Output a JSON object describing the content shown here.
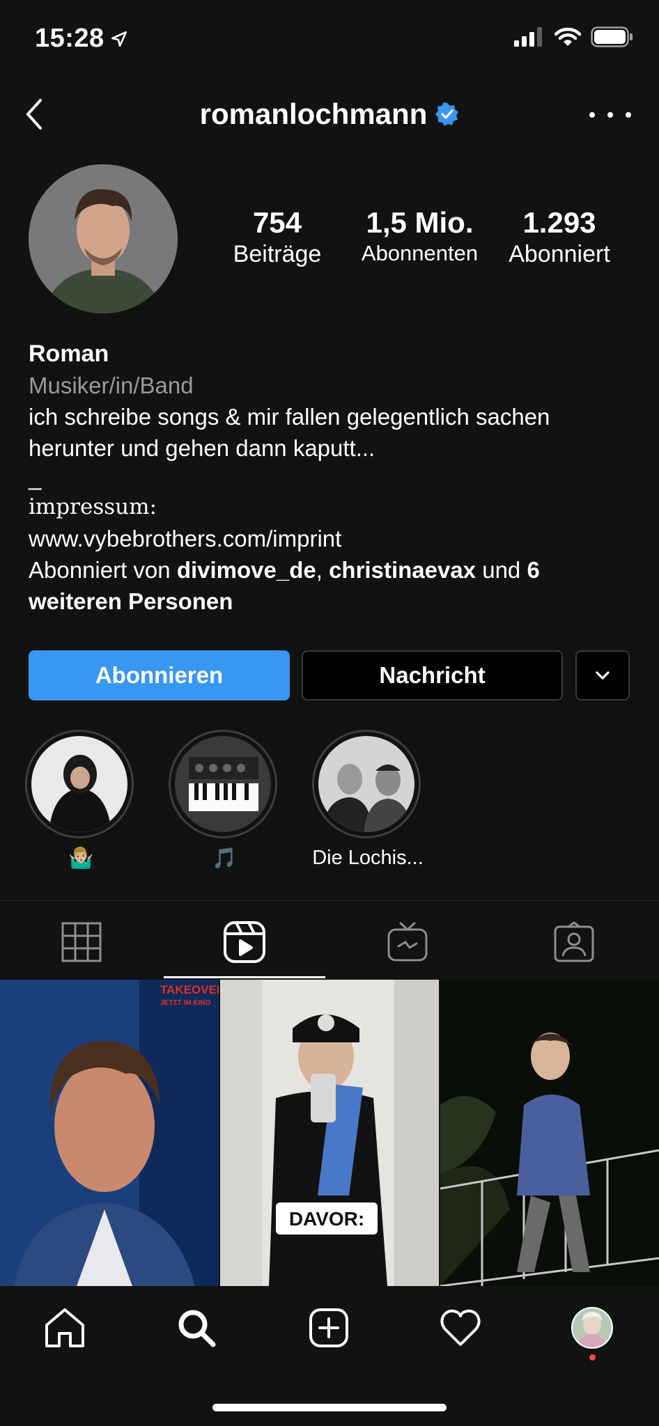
{
  "status": {
    "time": "15:28"
  },
  "header": {
    "username": "romanlochmann"
  },
  "stats": [
    {
      "value": "754",
      "label": "Beiträge"
    },
    {
      "value": "1,5 Mio.",
      "label": "Abonnenten"
    },
    {
      "value": "1.293",
      "label": "Abonniert"
    }
  ],
  "bio": {
    "name": "Roman",
    "category": "Musiker/in/Band",
    "text_line1": "ich schreibe songs & mir fallen gelegentlich sachen",
    "text_line2": "herunter und gehen dann kaputt...",
    "separator": "_",
    "impressum": "impressum:",
    "link": "www.vybebrothers.com/imprint",
    "followed_by_prefix": "Abonniert von ",
    "followed_by_user1": "divimove_de",
    "followed_by_comma": ", ",
    "followed_by_user2": "christinaevax",
    "followed_by_and": " und ",
    "followed_by_more_1": "6",
    "followed_by_more_2": "weiteren Personen"
  },
  "actions": {
    "follow_label": "Abonnieren",
    "message_label": "Nachricht"
  },
  "highlights": [
    {
      "label": "🤷🏼‍♂️"
    },
    {
      "label": "🎵"
    },
    {
      "label": "Die Lochis..."
    }
  ],
  "tiles": {
    "tile1_badge_line1": "TAKEOVER",
    "tile1_badge_line2": "JETZT IM KINO",
    "tile2_caption": "DAVOR:"
  },
  "colors": {
    "accent": "#3897f0",
    "background": "#121212",
    "notification_dot": "#ed4956"
  }
}
